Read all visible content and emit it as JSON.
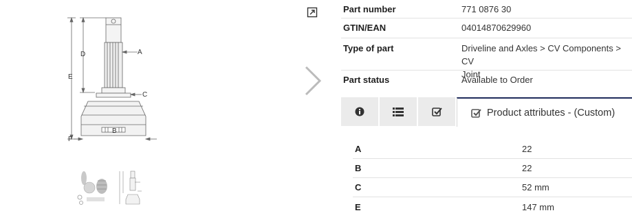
{
  "gallery": {
    "main_image": "cv-joint-dimension-drawing",
    "dimension_labels": [
      "A",
      "B",
      "C",
      "D",
      "E",
      "F"
    ],
    "thumbnails": [
      "cv-joint-kit-photo",
      "cv-joint-dimension-drawing"
    ],
    "expand_icon": "expand-icon",
    "next_icon": "chevron-right-icon"
  },
  "info": [
    {
      "key": "Part number",
      "value": "771 0876 30"
    },
    {
      "key": "GTIN/EAN",
      "value": "04014870629960"
    },
    {
      "key": "Type of part",
      "value_line1": "Driveline and Axles > CV Components > CV",
      "value_line2": "Joint"
    },
    {
      "key": "Part status",
      "value": "Available to Order"
    }
  ],
  "tabs": {
    "icons": [
      "info-circle-icon",
      "list-icon",
      "check-square-icon"
    ],
    "active_label": "Product attributes - (Custom)",
    "active_icon": "check-square-icon"
  },
  "attributes": [
    {
      "key": "A",
      "value": "22"
    },
    {
      "key": "B",
      "value": "22"
    },
    {
      "key": "C",
      "value": "52 mm"
    },
    {
      "key": "E",
      "value": "147 mm"
    }
  ],
  "colors": {
    "tab_bg": "#ebebeb",
    "active_border": "#1e2a5a",
    "row_border": "#e2e2e2",
    "icon": "#333333"
  }
}
